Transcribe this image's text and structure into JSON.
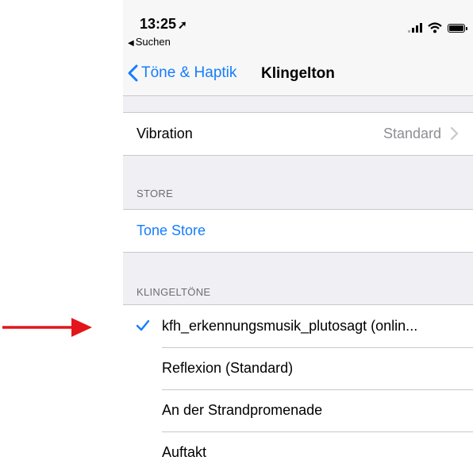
{
  "status_bar": {
    "time": "13:25",
    "location_arrow": "➚",
    "back_app": "Suchen",
    "back_triangle": "◀"
  },
  "nav": {
    "back_label": "Töne & Haptik",
    "title": "Klingelton"
  },
  "vibration_row": {
    "label": "Vibration",
    "value": "Standard"
  },
  "store": {
    "header": "STORE",
    "item": "Tone Store"
  },
  "ringtones": {
    "header": "KLINGELTÖNE",
    "items": [
      "kfh_erkennungsmusik_plutosagt (onlin...",
      "Reflexion (Standard)",
      "An der Strandpromenade",
      "Auftakt"
    ],
    "selected_index": 0
  },
  "colors": {
    "accent": "#147efb",
    "annotation_arrow": "#e3151a",
    "grouped_background": "#efeff4"
  }
}
